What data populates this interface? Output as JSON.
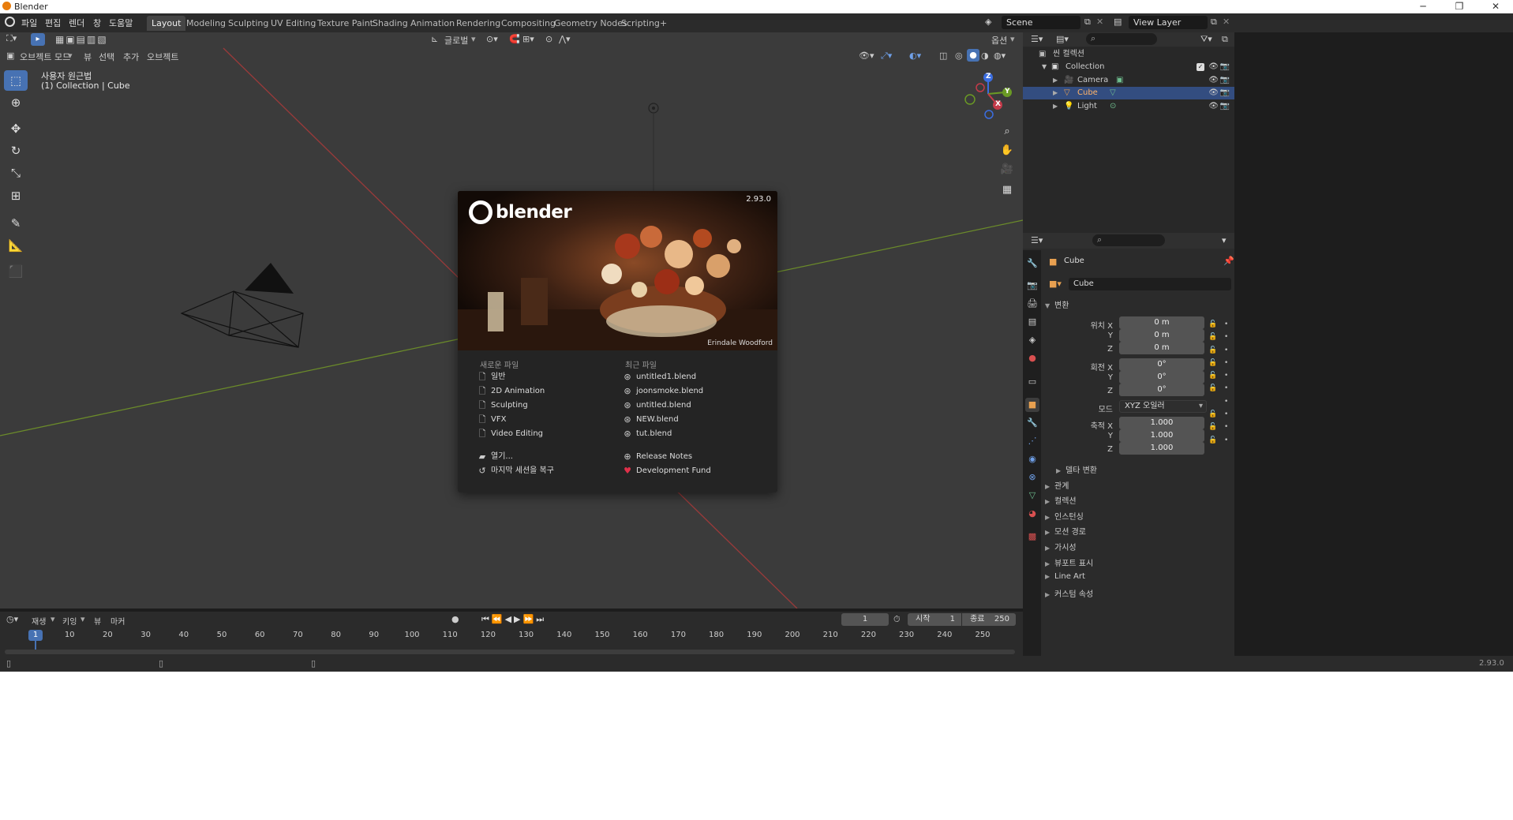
{
  "window": {
    "title": "Blender",
    "controls": [
      "─",
      "❐",
      "✕"
    ]
  },
  "menu": [
    "파일",
    "편집",
    "렌더",
    "창",
    "도움말"
  ],
  "workspaces": [
    "Layout",
    "Modeling",
    "Sculpting",
    "UV Editing",
    "Texture Paint",
    "Shading",
    "Animation",
    "Rendering",
    "Compositing",
    "Geometry Nodes",
    "Scripting",
    "+"
  ],
  "active_workspace": "Layout",
  "scene_field": "Scene",
  "view_layer_field": "View Layer",
  "viewport": {
    "transform_orientation": "글로벌",
    "options_label": "옵션",
    "mode": "오브젝트 모드",
    "header_menus": [
      "뷰",
      "선택",
      "추가",
      "오브젝트"
    ],
    "overlay_line1": "사용자 원근법",
    "overlay_line2": "(1) Collection | Cube",
    "gizmo_axes": [
      "Z",
      "Y",
      "X"
    ]
  },
  "splash": {
    "version": "2.93.0",
    "logo_text": "blender",
    "credit": "Erindale Woodford",
    "new_file_heading": "새로운 파일",
    "recent_heading": "최근 파일",
    "new_items": [
      "일반",
      "2D Animation",
      "Sculpting",
      "VFX",
      "Video Editing"
    ],
    "recent_items": [
      "untitled1.blend",
      "joonsmoke.blend",
      "untitled.blend",
      "NEW.blend",
      "tut.blend"
    ],
    "open_label": "열기...",
    "recover_label": "마지막 세션을 복구",
    "release_notes": "Release Notes",
    "dev_fund": "Development Fund"
  },
  "outliner": {
    "root": "씬 컬렉션",
    "collection": "Collection",
    "items": [
      "Camera",
      "Cube",
      "Light"
    ],
    "selected": "Cube"
  },
  "properties": {
    "object_name_header": "Cube",
    "object_name_field": "Cube",
    "transform_panel": "변환",
    "location_label": "위치 X",
    "rotation_label": "회전 X",
    "scale_label": "축적 X",
    "mode_label": "모드",
    "mode_value": "XYZ 오일러",
    "y_label": "Y",
    "z_label": "Z",
    "location": [
      "0 m",
      "0 m",
      "0 m"
    ],
    "rotation": [
      "0°",
      "0°",
      "0°"
    ],
    "scale": [
      "1.000",
      "1.000",
      "1.000"
    ],
    "delta_panel": "델타 변환",
    "panels": [
      "관계",
      "컬렉션",
      "인스턴싱",
      "모션 경로",
      "가시성",
      "뷰포트 표시",
      "Line Art",
      "커스텀 속성"
    ]
  },
  "timeline": {
    "menus": [
      "재생",
      "키잉",
      "뷰",
      "마커"
    ],
    "current_frame": "1",
    "start_label": "시작",
    "start": "1",
    "end_label": "종료",
    "end": "250",
    "ruler": [
      "1",
      "10",
      "20",
      "30",
      "40",
      "50",
      "60",
      "70",
      "80",
      "90",
      "100",
      "110",
      "120",
      "130",
      "140",
      "150",
      "160",
      "170",
      "180",
      "190",
      "200",
      "210",
      "220",
      "230",
      "240",
      "250"
    ]
  },
  "status_version": "2.93.0"
}
